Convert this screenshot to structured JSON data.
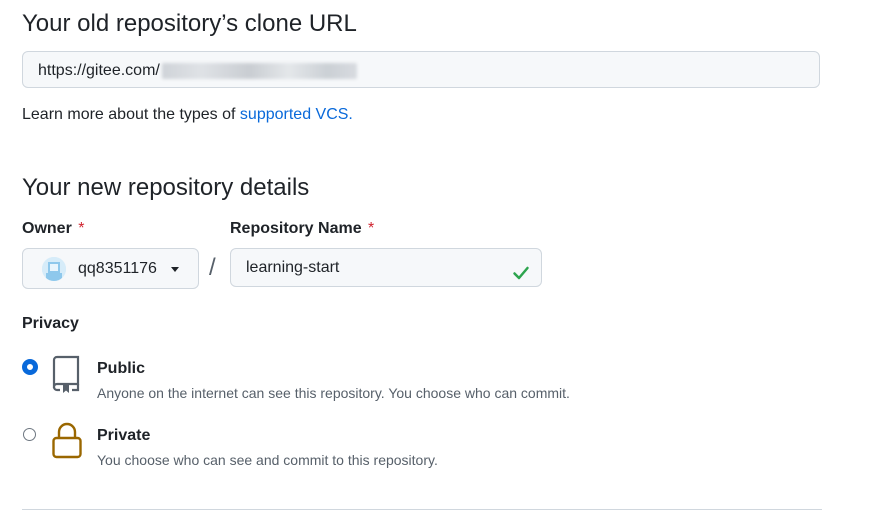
{
  "old_repo": {
    "heading": "Your old repository’s clone URL",
    "clone_url": "https://gitee.com/",
    "learn_prefix": "Learn more about the types of ",
    "learn_link": "supported VCS."
  },
  "new_repo": {
    "heading": "Your new repository details",
    "owner_label": "Owner",
    "owner_required": "*",
    "owner_value": "qq8351176",
    "separator": "/",
    "name_label": "Repository Name",
    "name_required": "*",
    "name_value": "learning-start"
  },
  "privacy": {
    "label": "Privacy",
    "selected": "public",
    "options": [
      {
        "id": "public",
        "title": "Public",
        "description": "Anyone on the internet can see this repository. You choose who can commit.",
        "icon": "repo-book-icon"
      },
      {
        "id": "private",
        "title": "Private",
        "description": "You choose who can see and commit to this repository.",
        "icon": "lock-icon"
      }
    ]
  },
  "colors": {
    "link": "#0969da",
    "required": "#cf222e",
    "valid_check": "#2da44e",
    "lock": "#9a6700"
  }
}
